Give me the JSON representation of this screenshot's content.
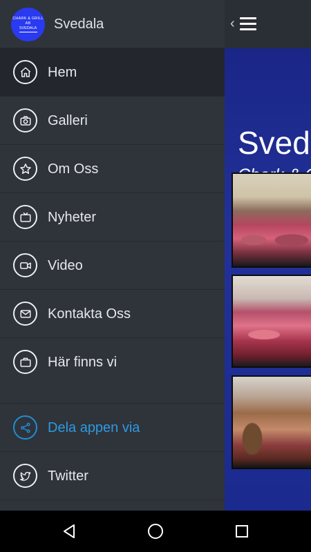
{
  "app_screen": {
    "title": "Sveda",
    "subtitle": "Chark & C",
    "menu_button_icon": "hamburger-icon",
    "banner_color": "#1c2a8a"
  },
  "drawer": {
    "logo": {
      "line1": "CHARK & GRILL AB",
      "line2": "SVEDALA",
      "color": "#2a3af0"
    },
    "title": "Svedala",
    "items": [
      {
        "label": "Hem",
        "icon": "home-icon",
        "active": true
      },
      {
        "label": "Galleri",
        "icon": "camera-icon"
      },
      {
        "label": "Om Oss",
        "icon": "star-icon"
      },
      {
        "label": "Nyheter",
        "icon": "tv-icon"
      },
      {
        "label": "Video",
        "icon": "video-camera-icon"
      },
      {
        "label": "Kontakta Oss",
        "icon": "mail-icon"
      },
      {
        "label": "Här finns vi",
        "icon": "briefcase-icon"
      }
    ],
    "share": {
      "label": "Dela appen via",
      "icon": "share-icon",
      "color": "#2b9be4"
    },
    "social": [
      {
        "label": "Twitter",
        "icon": "twitter-icon"
      }
    ]
  },
  "navbar": {
    "back": "back-icon",
    "home": "home-circle-icon",
    "recent": "recent-apps-icon"
  }
}
